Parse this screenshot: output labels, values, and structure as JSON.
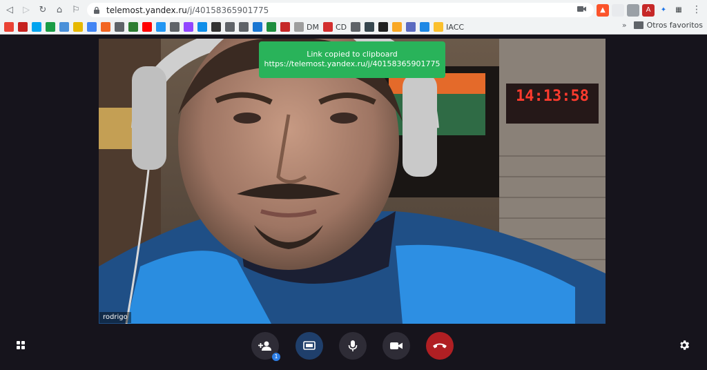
{
  "browser": {
    "url_host": "telemost.yandex.ru",
    "url_path": "/j/40158365901775",
    "bookmarks": [
      {
        "icon": "gmail-icon",
        "label": "",
        "color": "#ea4335"
      },
      {
        "icon": "mail-icon",
        "label": "",
        "color": "#c5221f"
      },
      {
        "icon": "windows-icon",
        "label": "",
        "color": "#00a4ef"
      },
      {
        "icon": "number-1-icon",
        "label": "",
        "color": "#1a9c45"
      },
      {
        "icon": "bookmark-icon",
        "label": "",
        "color": "#4a90d9"
      },
      {
        "icon": "e-icon",
        "label": "",
        "color": "#e6b800"
      },
      {
        "icon": "google-icon",
        "label": "",
        "color": "#4285f4"
      },
      {
        "icon": "orange-square-icon",
        "label": "",
        "color": "#f26522"
      },
      {
        "icon": "bank-icon",
        "label": "",
        "color": "#5f6368"
      },
      {
        "icon": "rt-icon",
        "label": "",
        "color": "#2e7d32"
      },
      {
        "icon": "youtube-icon",
        "label": "",
        "color": "#ff0000"
      },
      {
        "icon": "download-icon",
        "label": "",
        "color": "#2196f3"
      },
      {
        "icon": "puzzle-icon",
        "label": "",
        "color": "#5f6368"
      },
      {
        "icon": "twitch-icon",
        "label": "",
        "color": "#9146ff"
      },
      {
        "icon": "teamviewer-icon",
        "label": "",
        "color": "#0e8ee9"
      },
      {
        "icon": "card-icon",
        "label": "",
        "color": "#333333"
      },
      {
        "icon": "globe-icon",
        "label": "",
        "color": "#5f6368"
      },
      {
        "icon": "plane-icon",
        "label": "",
        "color": "#5f6368"
      },
      {
        "icon": "t-icon",
        "label": "",
        "color": "#1976d2"
      },
      {
        "icon": "lock-icon",
        "label": "",
        "color": "#1e8e3e"
      },
      {
        "icon": "s-icon",
        "label": "",
        "color": "#c62828"
      },
      {
        "icon": "dm-icon",
        "label": "DM",
        "color": "#9e9e9e"
      },
      {
        "icon": "chile-flag-icon",
        "label": "CD",
        "color": "#d32f2f"
      },
      {
        "icon": "globe-icon",
        "label": "",
        "color": "#5f6368"
      },
      {
        "icon": "shield-icon",
        "label": "",
        "color": "#37474f"
      },
      {
        "icon": "check-icon",
        "label": "",
        "color": "#212121"
      },
      {
        "icon": "coin-icon",
        "label": "",
        "color": "#f9a825"
      },
      {
        "icon": "at-icon",
        "label": "",
        "color": "#5c6bc0"
      },
      {
        "icon": "infinity-icon",
        "label": "",
        "color": "#1e88e5"
      },
      {
        "icon": "iacc-icon",
        "label": "IACC",
        "color": "#fbc02d"
      }
    ],
    "other_bookmarks_label": "Otros favoritos"
  },
  "meeting": {
    "participant_name": "rodrigo",
    "toast_title": "Link copied to clipboard",
    "toast_url": "https://telemost.yandex.ru/j/40158365901775",
    "participant_count": "1",
    "clock_digits": "14:13:58"
  },
  "colors": {
    "toast": "#29b35a",
    "hangup": "#b01f23",
    "screen_share": "#1f3f6b",
    "background": "#16141c"
  }
}
